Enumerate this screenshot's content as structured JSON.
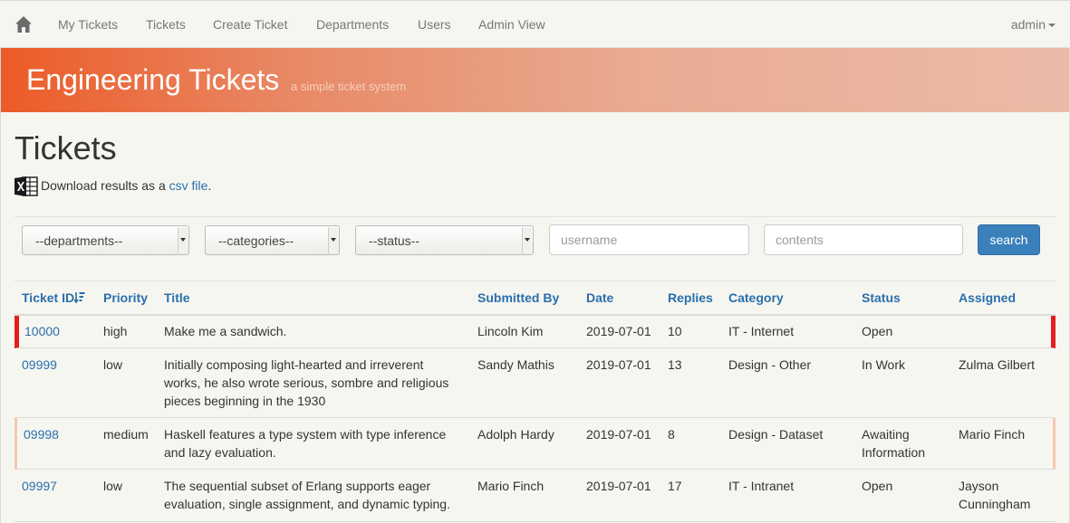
{
  "nav": {
    "home_icon": "home-icon",
    "items": [
      "My Tickets",
      "Tickets",
      "Create Ticket",
      "Departments",
      "Users",
      "Admin View"
    ],
    "user": "admin"
  },
  "banner": {
    "title": "Engineering Tickets",
    "subtitle": "a simple ticket system"
  },
  "page": {
    "title": "Tickets",
    "download_icon": "excel-icon",
    "download_prefix": "Download results as a ",
    "download_link": "csv file",
    "download_suffix": "."
  },
  "filters": {
    "departments": "--departments--",
    "categories": "--categories--",
    "status": "--status--",
    "username_placeholder": "username",
    "contents_placeholder": "contents",
    "search_label": "search"
  },
  "table": {
    "columns": [
      "Ticket ID",
      "Priority",
      "Title",
      "Submitted By",
      "Date",
      "Replies",
      "Category",
      "Status",
      "Assigned"
    ],
    "sort_icon": "sort-descending-icon",
    "rows": [
      {
        "id": "10000",
        "priority": "high",
        "title": "Make me a sandwich.",
        "submitted_by": "Lincoln Kim",
        "date": "2019-07-01",
        "replies": "10",
        "category": "IT - Internet",
        "status": "Open",
        "assigned": ""
      },
      {
        "id": "09999",
        "priority": "low",
        "title": "Initially composing light-hearted and irreverent works, he also wrote serious, sombre and religious pieces beginning in the 1930",
        "submitted_by": "Sandy Mathis",
        "date": "2019-07-01",
        "replies": "13",
        "category": "Design - Other",
        "status": "In Work",
        "assigned": "Zulma Gilbert"
      },
      {
        "id": "09998",
        "priority": "medium",
        "title": "Haskell features a type system with type inference and lazy evaluation.",
        "submitted_by": "Adolph Hardy",
        "date": "2019-07-01",
        "replies": "8",
        "category": "Design - Dataset",
        "status": "Awaiting Information",
        "assigned": "Mario Finch"
      },
      {
        "id": "09997",
        "priority": "low",
        "title": "The sequential subset of Erlang supports eager evaluation, single assignment, and dynamic typing.",
        "submitted_by": "Mario Finch",
        "date": "2019-07-01",
        "replies": "17",
        "category": "IT - Intranet",
        "status": "Open",
        "assigned": "Jayson Cunningham"
      }
    ]
  },
  "colors": {
    "link": "#2a6fac",
    "high_priority": "#e41e1e",
    "medium_priority": "#f5c8b0",
    "banner_start": "#ec5b27",
    "search_button": "#3a80bb"
  }
}
